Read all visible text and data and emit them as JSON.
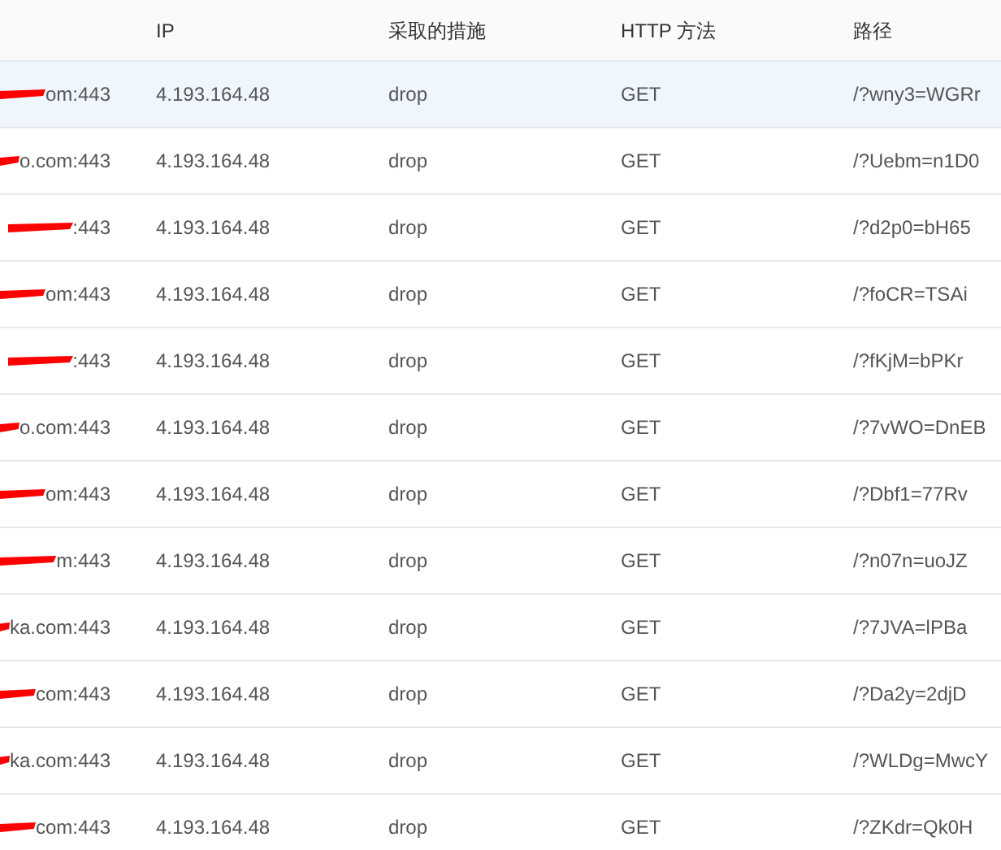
{
  "table": {
    "columns": [
      "IP",
      "采取的措施",
      "HTTP 方法",
      "路径"
    ],
    "rows": [
      {
        "host": "om:443",
        "ip": "4.193.164.48",
        "action": "drop",
        "method": "GET",
        "path": "/?wny3=WGRr",
        "selected": true
      },
      {
        "host": "o.com:443",
        "ip": "4.193.164.48",
        "action": "drop",
        "method": "GET",
        "path": "/?Uebm=n1D0",
        "selected": false
      },
      {
        "host": ":443",
        "ip": "4.193.164.48",
        "action": "drop",
        "method": "GET",
        "path": "/?d2p0=bH65",
        "selected": false
      },
      {
        "host": "om:443",
        "ip": "4.193.164.48",
        "action": "drop",
        "method": "GET",
        "path": "/?foCR=TSAi",
        "selected": false
      },
      {
        "host": ":443",
        "ip": "4.193.164.48",
        "action": "drop",
        "method": "GET",
        "path": "/?fKjM=bPKr",
        "selected": false
      },
      {
        "host": "o.com:443",
        "ip": "4.193.164.48",
        "action": "drop",
        "method": "GET",
        "path": "/?7vWO=DnEB",
        "selected": false
      },
      {
        "host": "om:443",
        "ip": "4.193.164.48",
        "action": "drop",
        "method": "GET",
        "path": "/?Dbf1=77Rv",
        "selected": false
      },
      {
        "host": "m:443",
        "ip": "4.193.164.48",
        "action": "drop",
        "method": "GET",
        "path": "/?n07n=uoJZ",
        "selected": false
      },
      {
        "host": "ka.com:443",
        "ip": "4.193.164.48",
        "action": "drop",
        "method": "GET",
        "path": "/?7JVA=lPBa",
        "selected": false
      },
      {
        "host": "com:443",
        "ip": "4.193.164.48",
        "action": "drop",
        "method": "GET",
        "path": "/?Da2y=2djD",
        "selected": false
      },
      {
        "host": "ka.com:443",
        "ip": "4.193.164.48",
        "action": "drop",
        "method": "GET",
        "path": "/?WLDg=MwcY",
        "selected": false
      },
      {
        "host": "com:443",
        "ip": "4.193.164.48",
        "action": "drop",
        "method": "GET",
        "path": "/?ZKdr=Qk0H",
        "selected": false
      }
    ]
  }
}
